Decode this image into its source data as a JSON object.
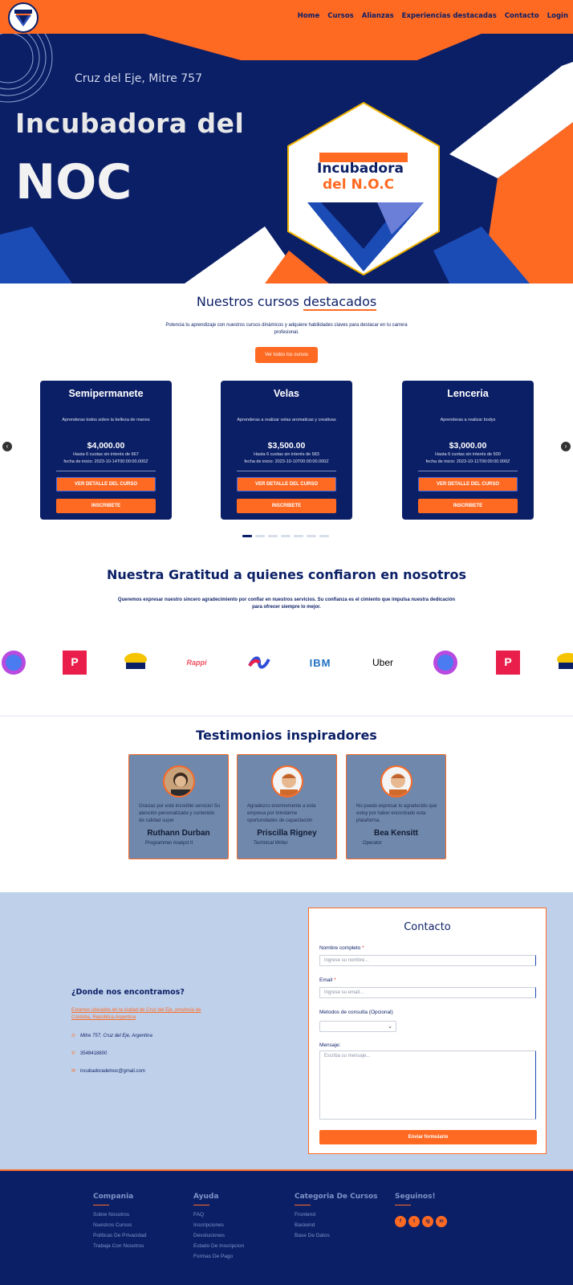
{
  "nav": {
    "links": [
      "Home",
      "Cursos",
      "Alianzas",
      "Experiencias destacadas",
      "Contacto",
      "Login"
    ],
    "logo_text": "Incubadora del N.O.C"
  },
  "hero": {
    "address": "Cruz del Eje, Mitre 757",
    "title_line1": "Incubadora del",
    "title_line2": "NOC",
    "badge_line1": "Incubadora",
    "badge_line2": "del N.O.C"
  },
  "courses_section": {
    "title_a": "Nuestros cursos",
    "title_b": "destacados",
    "subtitle": "Potencia tu aprendizaje con nuestros cursos dinámicos y adquiere habilidades claves para destacar en tu carrera profesional.",
    "button": "Ver todos los cursos",
    "prev_icon": "chevron-left-icon",
    "next_icon": "chevron-right-icon",
    "courses": [
      {
        "name": "Semipermanete",
        "desc": "Aprenderas todos sobre la belleza de manos",
        "price": "$4,000.00",
        "plan": "Hasta 6 cuotas sin interés de 667",
        "date": "fecha de inicio: 2023-10-14T00:00:00.000Z",
        "detail": "VER DETALLE DEL CURSO",
        "enroll": "INSCRIBETE"
      },
      {
        "name": "Velas",
        "desc": "Aprenderas a realizar velas aromaticas y creativas",
        "price": "$3,500.00",
        "plan": "Hasta 6 cuotas sin interés de 583",
        "date": "fecha de inicio: 2023-10-10T00:00:00.000Z",
        "detail": "VER DETALLE DEL CURSO",
        "enroll": "INSCRIBETE"
      },
      {
        "name": "Lenceria",
        "desc": "Aprenderas a realizar bodys",
        "price": "$3,000.00",
        "plan": "Hasta 6 cuotas sin interés de 500",
        "date": "fecha de inicio: 2023-10-11T00:00:00.000Z",
        "detail": "VER DETALLE DEL CURSO",
        "enroll": "INSCRIBETE"
      }
    ]
  },
  "gratitude": {
    "title": "Nuestra Gratitud a quienes confiaron en nosotros",
    "text": "Queremos expresar nuestro sincero agradecimiento por confiar en nuestros servicios. Su confianza es el cimiento que impulsa nuestra dedicación para ofrecer siempre lo mejor.",
    "brands": [
      "Pedidos Ya",
      "Rappi",
      "IBM",
      "Uber"
    ]
  },
  "testimonials": {
    "title": "Testimonios inspiradores",
    "items": [
      {
        "text": "Gracias por este increíble servicio! Su atención personalizada y contenido de calidad super",
        "name": "Ruthann Durban",
        "role": "Programmer Analyst II"
      },
      {
        "text": "Agradezco enormemente a esta empresa por brindarme oportunidades de capacitación",
        "name": "Priscilla Rigney",
        "role": "Technical Writer"
      },
      {
        "text": "No puedo expresar lo agradecido que estoy por haber encontrado esta plataforma.",
        "name": "Bea Kensitt",
        "role": "Operator"
      }
    ]
  },
  "location": {
    "title": "¿Donde nos encontramos?",
    "text": "Estamos ubicados en la ciudad de Cruz del Eje, provincia de Córdoba, República Argentina",
    "address": "Mitre 757, Cruz del Eje, Argentina",
    "phone": "3549418800",
    "email": "incubadoradelnoc@gmail.com"
  },
  "contact_form": {
    "title": "Contacto",
    "name_label": "Nombre completo",
    "name_placeholder": "Ingrese su nombre...",
    "email_label": "Email",
    "email_placeholder": "Ingrese su email...",
    "method_label": "Metodos de consulta (Opcional)",
    "message_label": "Mensaje:",
    "message_placeholder": "Escriba su mensaje...",
    "required_mark": "*",
    "submit": "Enviar formulario"
  },
  "footer": {
    "cols": [
      {
        "title": "Compania",
        "items": [
          "Sobre Nosotros",
          "Nuestros Cursos",
          "Politicas De Privacidad",
          "Trabaja Con Nosotros"
        ]
      },
      {
        "title": "Ayuda",
        "items": [
          "FAQ",
          "Inscripciones",
          "Devoluciones",
          "Estado De Inscripcion",
          "Formas De Pago"
        ]
      },
      {
        "title": "Categoria De Cursos",
        "items": [
          "Frontend",
          "Backend",
          "Base De Datos"
        ]
      },
      {
        "title": "Seguinos!",
        "items": []
      }
    ],
    "social": [
      "f",
      "t",
      "ig",
      "in"
    ]
  },
  "colors": {
    "primary": "#0b1f66",
    "accent": "#ff6a23",
    "light": "#bfd1ea"
  }
}
